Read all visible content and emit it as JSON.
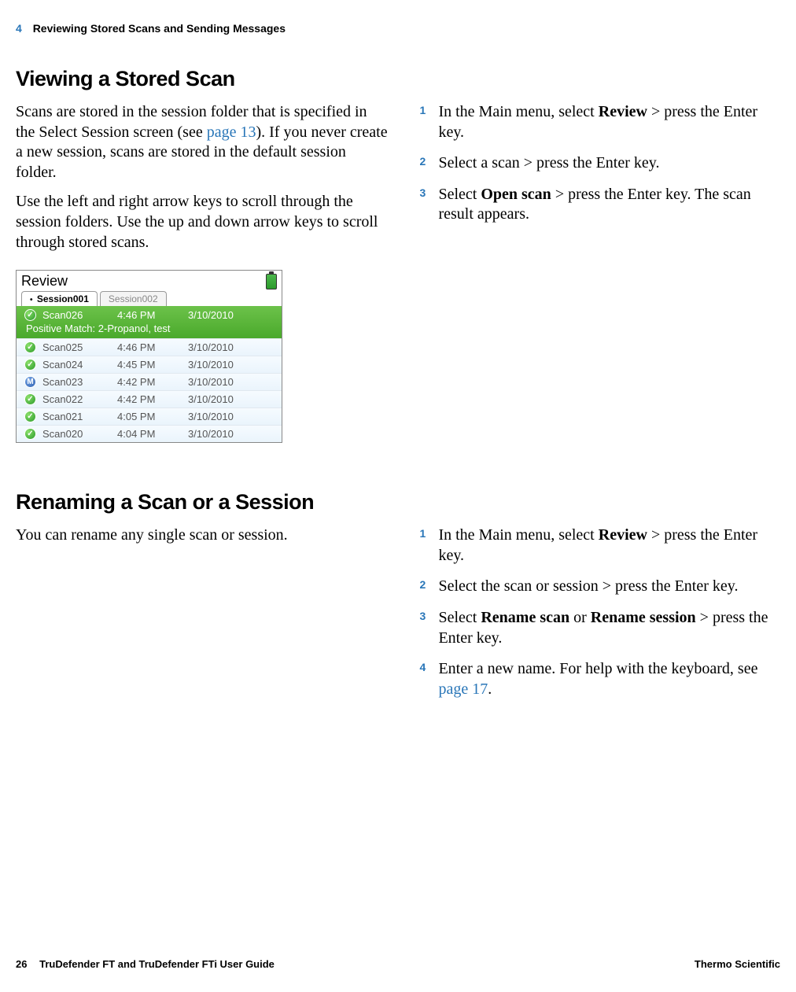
{
  "header": {
    "chapter": "4",
    "title": "Reviewing Stored Scans and Sending Messages"
  },
  "section1": {
    "heading": "Viewing a Stored Scan",
    "left_p1_a": "Scans are stored in the session folder that is specified in the Select Session screen (see ",
    "left_p1_link": "page 13",
    "left_p1_b": "). If you never create a new session, scans are stored in the default session folder.",
    "left_p2": "Use the left and right arrow keys to scroll through the session folders. Use the up and down arrow keys to scroll through stored scans.",
    "steps": {
      "s1_a": "In the Main menu, select ",
      "s1_b": "Review",
      "s1_c": " > press the Enter key.",
      "s2": "Select a scan > press the Enter key.",
      "s3_a": "Select ",
      "s3_b": "Open scan",
      "s3_c": " > press the Enter key. The scan result appears."
    }
  },
  "screenshot": {
    "title": "Review",
    "tabs": {
      "active": "Session001",
      "inactive": "Session002"
    },
    "selected": {
      "name": "Scan026",
      "time": "4:46 PM",
      "date": "3/10/2010",
      "sub": "Positive Match: 2-Propanol, test"
    },
    "rows": [
      {
        "icon": "g",
        "name": "Scan025",
        "time": "4:46 PM",
        "date": "3/10/2010"
      },
      {
        "icon": "g",
        "name": "Scan024",
        "time": "4:45 PM",
        "date": "3/10/2010"
      },
      {
        "icon": "m",
        "name": "Scan023",
        "time": "4:42 PM",
        "date": "3/10/2010"
      },
      {
        "icon": "g",
        "name": "Scan022",
        "time": "4:42 PM",
        "date": "3/10/2010"
      },
      {
        "icon": "g",
        "name": "Scan021",
        "time": "4:05 PM",
        "date": "3/10/2010"
      },
      {
        "icon": "g",
        "name": "Scan020",
        "time": "4:04 PM",
        "date": "3/10/2010"
      }
    ]
  },
  "section2": {
    "heading": "Renaming a Scan or a Session",
    "left_p1": "You can rename any single scan or session.",
    "steps": {
      "s1_a": "In the Main menu, select ",
      "s1_b": "Review",
      "s1_c": " > press the Enter key.",
      "s2": "Select the scan or session > press the Enter key.",
      "s3_a": "Select ",
      "s3_b": "Rename scan",
      "s3_c": " or ",
      "s3_d": "Rename session",
      "s3_e": " > press the Enter key.",
      "s4_a": "Enter a new name. For help with the keyboard, see ",
      "s4_link": "page 17",
      "s4_b": "."
    }
  },
  "footer": {
    "page": "26",
    "doc": "TruDefender FT and TruDefender FTi User Guide",
    "brand": "Thermo Scientific"
  }
}
